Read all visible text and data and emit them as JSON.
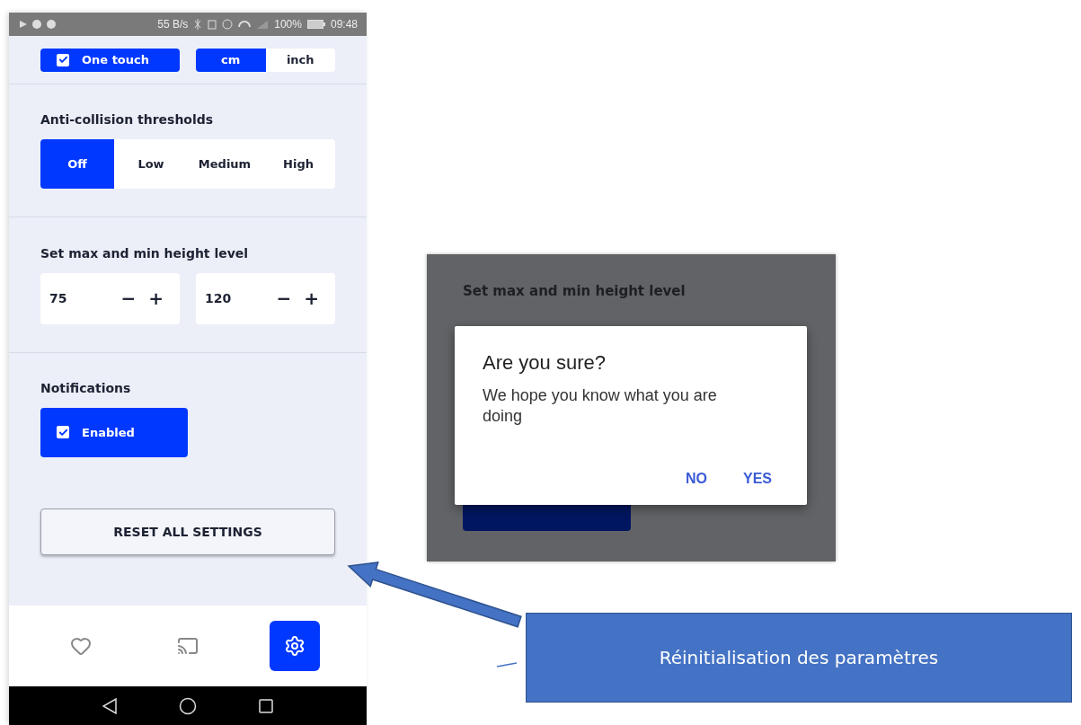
{
  "status_bar": {
    "speed": "55 B/s",
    "battery": "100%",
    "time": "09:48"
  },
  "settings_screen": {
    "top_row": {
      "one_touch": {
        "label": "One touch",
        "checked": true
      },
      "units": [
        {
          "label": "cm",
          "selected": true
        },
        {
          "label": "inch",
          "selected": false
        }
      ]
    },
    "anti_collision": {
      "title": "Anti-collision thresholds",
      "options": [
        {
          "label": "Off",
          "selected": true
        },
        {
          "label": "Low",
          "selected": false
        },
        {
          "label": "Medium",
          "selected": false
        },
        {
          "label": "High",
          "selected": false
        }
      ]
    },
    "height_level": {
      "title": "Set max and min height level",
      "steppers": [
        {
          "value": "75",
          "minus": "−",
          "plus": "+"
        },
        {
          "value": "120",
          "minus": "−",
          "plus": "+"
        }
      ]
    },
    "notifications": {
      "title": "Notifications",
      "enabled": {
        "label": "Enabled",
        "checked": true
      }
    },
    "reset_button": "RESET ALL SETTINGS",
    "bottom_nav": [
      {
        "kind": "favorites",
        "selected": false
      },
      {
        "kind": "cast",
        "selected": false
      },
      {
        "kind": "settings",
        "selected": true
      }
    ]
  },
  "dialog_screen": {
    "background_title": "Set max and min height level",
    "dialog": {
      "title": "Are you sure?",
      "message": "We hope you know what you are doing",
      "buttons": [
        "NO",
        "YES"
      ]
    }
  },
  "callout": {
    "text": "Réinitialisation des paramètres"
  }
}
